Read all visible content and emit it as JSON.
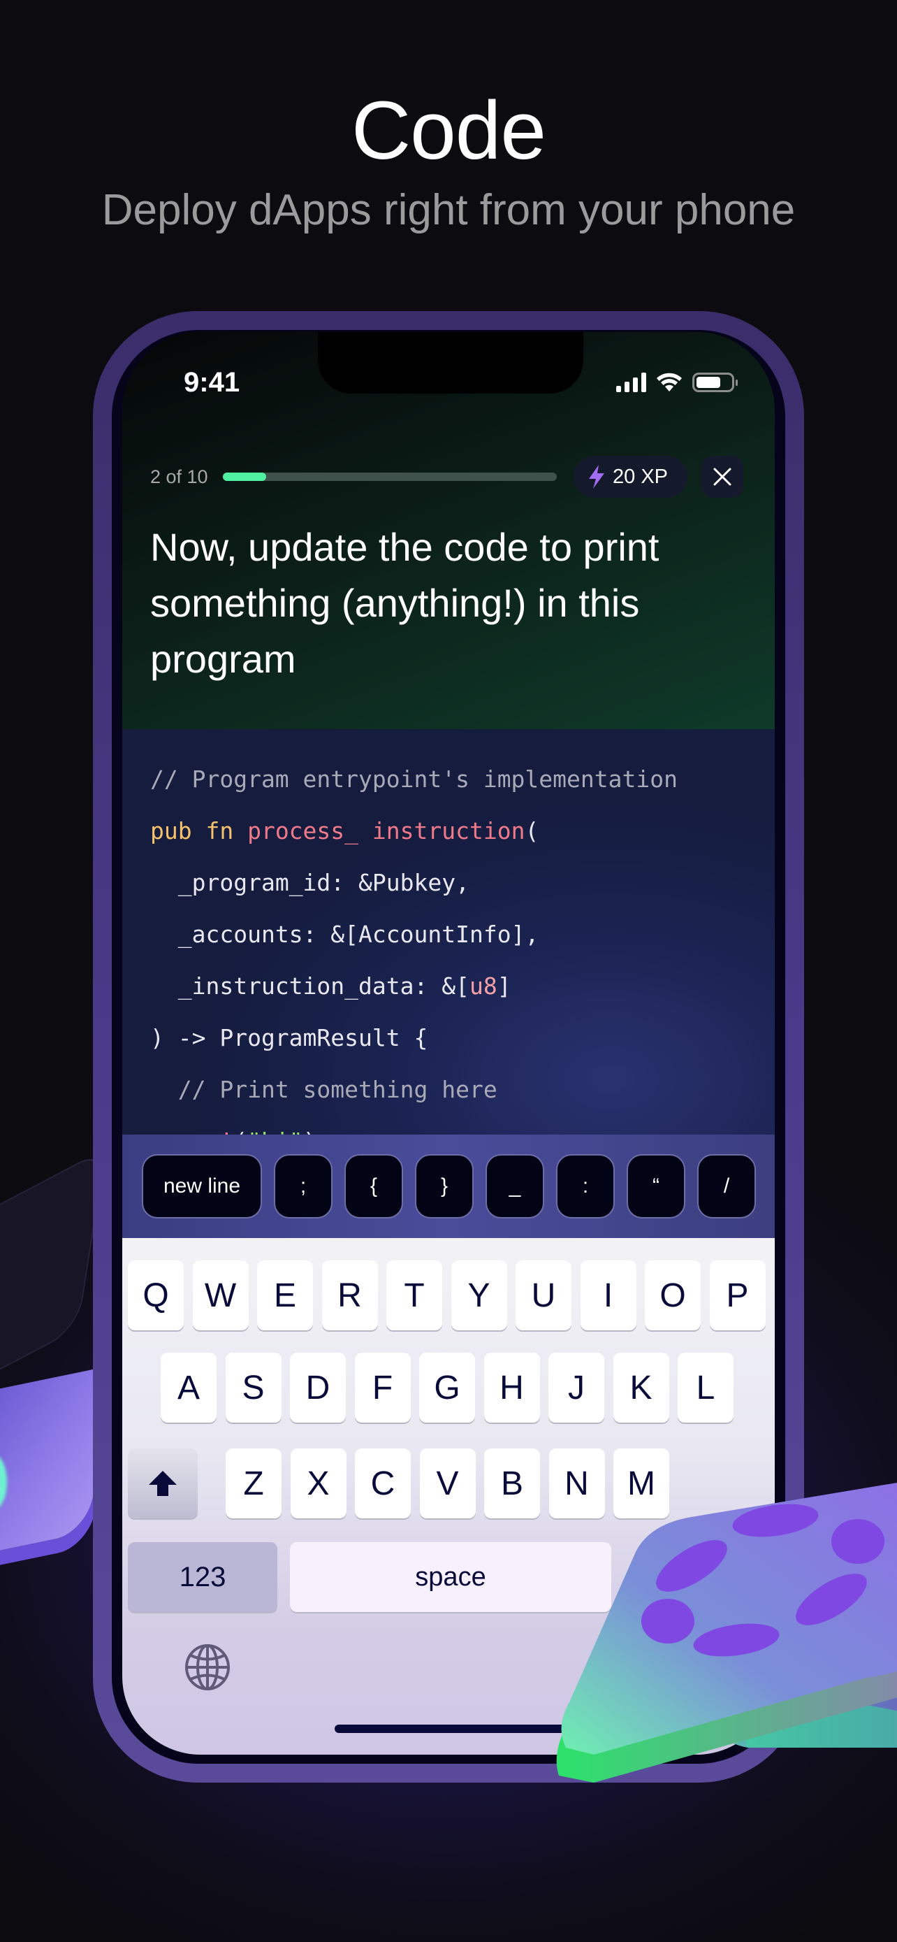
{
  "hero": {
    "title": "Code",
    "subtitle": "Deploy dApps right from your phone"
  },
  "status_bar": {
    "time": "9:41",
    "icons": [
      "signal-icon",
      "wifi-icon",
      "battery-icon"
    ]
  },
  "lesson": {
    "step_label": "2 of 10",
    "progress_fraction": 0.13,
    "xp_label": "20 XP",
    "xp_icon": "lightning-icon",
    "close_icon": "close-icon",
    "question": "Now, update the code to print something (anything!) in this program"
  },
  "code": {
    "lines": [
      {
        "indent": "",
        "parts": [
          {
            "t": "// Program entrypoint's implementation",
            "c": "comment"
          }
        ]
      },
      {
        "indent": "",
        "parts": [
          {
            "t": "pub fn ",
            "c": "kw"
          },
          {
            "t": "process_ instruction",
            "c": "fn"
          },
          {
            "t": "(",
            "c": "plain"
          }
        ]
      },
      {
        "indent": "  ",
        "parts": [
          {
            "t": "_program_id: &Pubkey,",
            "c": "plain"
          }
        ]
      },
      {
        "indent": "  ",
        "parts": [
          {
            "t": "_accounts: &[AccountInfo],",
            "c": "plain"
          }
        ]
      },
      {
        "indent": "  ",
        "parts": [
          {
            "t": "_instruction_data: &[",
            "c": "plain"
          },
          {
            "t": "u8",
            "c": "type"
          },
          {
            "t": "]",
            "c": "plain"
          }
        ]
      },
      {
        "indent": "",
        "parts": [
          {
            "t": ") -> ProgramResult {",
            "c": "plain"
          }
        ]
      },
      {
        "indent": "  ",
        "parts": [
          {
            "t": "// Print something here",
            "c": "comment"
          }
        ]
      },
      {
        "indent": "  ",
        "parts": [
          {
            "t": "msg!",
            "c": "fn"
          },
          {
            "t": "(",
            "c": "plain"
          },
          {
            "t": "\"hi\"",
            "c": "str"
          },
          {
            "t": ")",
            "c": "plain"
          }
        ]
      }
    ]
  },
  "accessory_keys": [
    "new line",
    ";",
    "{",
    "}",
    "_",
    ":",
    "“",
    "/"
  ],
  "keyboard": {
    "row1": [
      "Q",
      "W",
      "E",
      "R",
      "T",
      "Y",
      "U",
      "I",
      "O",
      "P"
    ],
    "row2": [
      "A",
      "S",
      "D",
      "F",
      "G",
      "H",
      "J",
      "K",
      "L"
    ],
    "row3": [
      "Z",
      "X",
      "C",
      "V",
      "B",
      "N",
      "M"
    ],
    "shift_icon": "shift-icon",
    "numbers_label": "123",
    "space_label": "space",
    "globe_icon": "globe-icon"
  },
  "colors": {
    "progress_fill": "#4ff0a2",
    "xp_bolt": "#a36cf5",
    "code_keyword": "#f5c26b",
    "code_function": "#f07a8a",
    "code_comment": "#a9aab8"
  }
}
